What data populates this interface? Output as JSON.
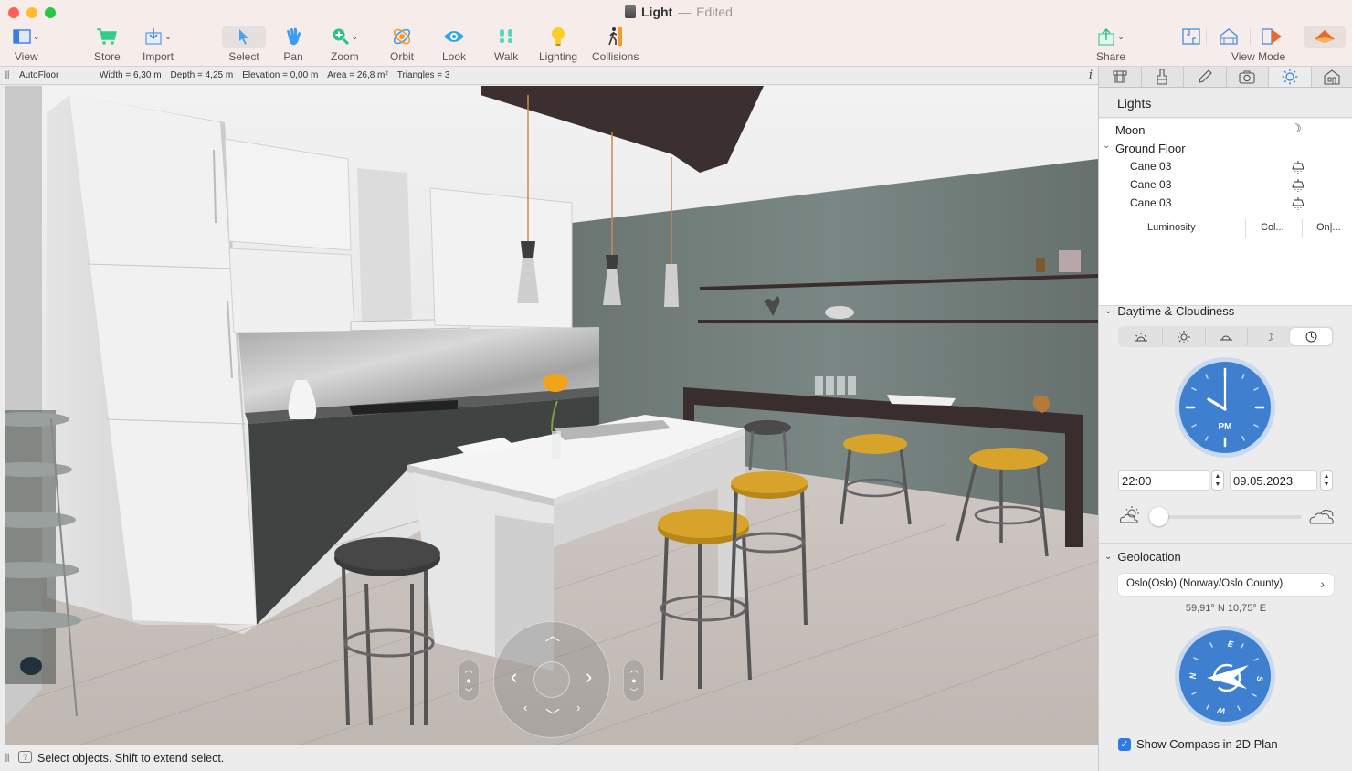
{
  "window": {
    "title": "Light",
    "separator": "—",
    "status": "Edited"
  },
  "toolbar": {
    "items": [
      {
        "id": "view",
        "label": "View",
        "icon": "view-layout-icon",
        "has_menu": true
      },
      {
        "id": "store",
        "label": "Store",
        "icon": "cart-icon"
      },
      {
        "id": "import",
        "label": "Import",
        "icon": "import-icon",
        "has_menu": true
      },
      {
        "id": "select",
        "label": "Select",
        "icon": "cursor-arrow-icon",
        "active": true
      },
      {
        "id": "pan",
        "label": "Pan",
        "icon": "hand-icon"
      },
      {
        "id": "zoom",
        "label": "Zoom",
        "icon": "zoom-in-icon",
        "has_menu": true
      },
      {
        "id": "orbit",
        "label": "Orbit",
        "icon": "orbit-icon"
      },
      {
        "id": "look",
        "label": "Look",
        "icon": "eye-icon"
      },
      {
        "id": "walk",
        "label": "Walk",
        "icon": "footprints-icon"
      },
      {
        "id": "lighting",
        "label": "Lighting",
        "icon": "light-bulb-icon"
      },
      {
        "id": "collisions",
        "label": "Collisions",
        "icon": "walker-wall-icon"
      }
    ],
    "share_label": "Share",
    "view_mode_label": "View Mode",
    "view_modes": [
      "2d-plan",
      "3d-wireframe",
      "split-view",
      "3d-view"
    ],
    "active_view_mode": "3d-view"
  },
  "infobar": {
    "floor": "AutoFloor",
    "dims": [
      "Width = 6,30 m",
      "Depth = 4,25 m",
      "Elevation = 0,00 m",
      "Area = 26,8 m²",
      "Triangles = 3"
    ],
    "info_glyph": "i"
  },
  "statusbar": {
    "help_glyph": "?",
    "message": "Select objects. Shift to extend select."
  },
  "viewport": {
    "nav": {
      "up": "︿",
      "down": "﹀",
      "left": "‹",
      "right": "›"
    }
  },
  "panel": {
    "tabs": [
      {
        "id": "furniture",
        "icon": "furniture-icon"
      },
      {
        "id": "materials",
        "icon": "paint-brush-icon"
      },
      {
        "id": "edit",
        "icon": "pencil-icon"
      },
      {
        "id": "camera",
        "icon": "camera-icon"
      },
      {
        "id": "lights",
        "icon": "sun-icon",
        "active": true
      },
      {
        "id": "building",
        "icon": "house-icon"
      }
    ],
    "lights": {
      "title": "Lights",
      "items": [
        {
          "name": "Moon",
          "icon": "moon-icon",
          "level": 0
        },
        {
          "name": "Ground Floor",
          "level": 0,
          "expanded": true
        },
        {
          "name": "Cane 03",
          "icon": "pendant-lamp-icon",
          "level": 1
        },
        {
          "name": "Cane 03",
          "icon": "pendant-lamp-icon",
          "level": 1
        },
        {
          "name": "Cane 03",
          "icon": "pendant-lamp-icon",
          "level": 1
        }
      ],
      "columns": [
        "Luminosity",
        "Col...",
        "On|..."
      ]
    },
    "daytime": {
      "title": "Daytime & Cloudiness",
      "presets": [
        "sunrise",
        "noon",
        "sunset",
        "night",
        "custom-time"
      ],
      "active_preset": "custom-time",
      "clock_period": "PM",
      "time": "22:00",
      "date": "09.05.2023",
      "cloudiness": 0
    },
    "geolocation": {
      "title": "Geolocation",
      "location": "Oslo(Oslo) (Norway/Oslo County)",
      "coords": "59,91° N   10,75° E",
      "compass_labels": [
        "N",
        "E",
        "S",
        "W"
      ],
      "show_compass_label": "Show Compass in 2D Plan",
      "show_compass": true
    }
  }
}
